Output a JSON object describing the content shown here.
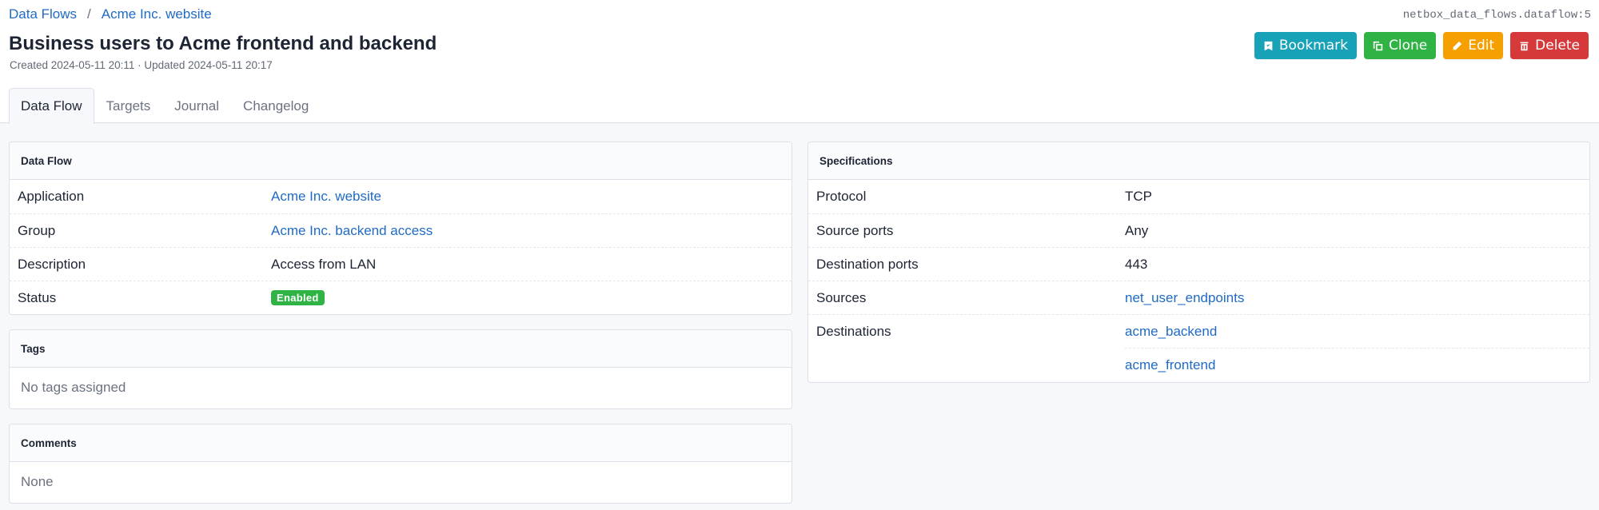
{
  "breadcrumb": [
    {
      "label": "Data Flows"
    },
    {
      "label": "Acme Inc. website"
    }
  ],
  "breadcrumb_separator": "/",
  "object_id": "netbox_data_flows.dataflow:5",
  "title": "Business users to Acme frontend and backend",
  "subtitle": "Created 2024-05-11 20:11 · Updated 2024-05-11 20:17",
  "actions": {
    "bookmark": {
      "label": "Bookmark",
      "icon": "bookmark-icon",
      "color": "#17a2b8"
    },
    "clone": {
      "label": "Clone",
      "icon": "clone-icon",
      "color": "#2fb344"
    },
    "edit": {
      "label": "Edit",
      "icon": "pencil-icon",
      "color": "#f59f00"
    },
    "delete": {
      "label": "Delete",
      "icon": "trash-icon",
      "color": "#d63939"
    }
  },
  "tabs": [
    {
      "label": "Data Flow",
      "active": true
    },
    {
      "label": "Targets",
      "active": false
    },
    {
      "label": "Journal",
      "active": false
    },
    {
      "label": "Changelog",
      "active": false
    }
  ],
  "data_flow_card": {
    "title": "Data Flow",
    "rows": [
      {
        "key": "Application",
        "value": "Acme Inc. website",
        "link": true
      },
      {
        "key": "Group",
        "value": "Acme Inc. backend access",
        "link": true
      },
      {
        "key": "Description",
        "value": "Access from LAN",
        "link": false
      },
      {
        "key": "Status",
        "value": "Enabled",
        "badge": true,
        "badge_color": "#2fb344"
      }
    ]
  },
  "tags_card": {
    "title": "Tags",
    "empty_text": "No tags assigned"
  },
  "comments_card": {
    "title": "Comments",
    "empty_text": "None"
  },
  "specifications_card": {
    "title": "Specifications",
    "rows": [
      {
        "key": "Protocol",
        "value": "TCP"
      },
      {
        "key": "Source ports",
        "value": "Any"
      },
      {
        "key": "Destination ports",
        "value": "443"
      },
      {
        "key": "Sources",
        "values": [
          "net_user_endpoints"
        ]
      },
      {
        "key": "Destinations",
        "values": [
          "acme_backend",
          "acme_frontend"
        ]
      }
    ]
  },
  "colors": {
    "link": "#206bc4",
    "page_bg": "#f6f8fb",
    "border": "#dce1e7"
  }
}
